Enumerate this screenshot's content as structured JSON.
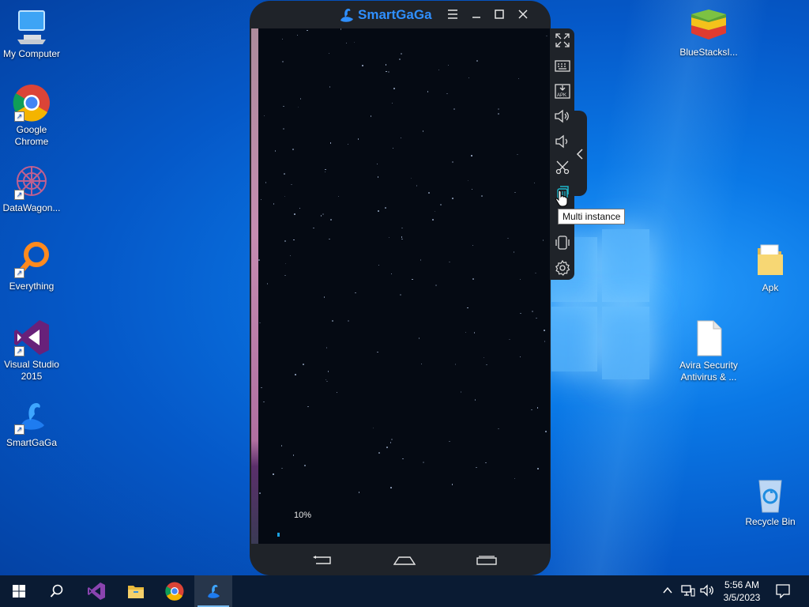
{
  "desktop_left": [
    {
      "label": "My Computer"
    },
    {
      "label": "Google Chrome"
    },
    {
      "label": "DataWagon..."
    },
    {
      "label": "Everything"
    },
    {
      "label": "Visual Studio 2015"
    },
    {
      "label": "SmartGaGa"
    }
  ],
  "desktop_right": [
    {
      "label": "BlueStacksI..."
    },
    {
      "label": "Apk"
    },
    {
      "label": "Avira Security Antivirus & ..."
    },
    {
      "label": "Recycle Bin"
    }
  ],
  "emulator": {
    "brand": "SmartGaGa",
    "loading_text": "10%",
    "loading_progress": 0.1,
    "tooltip": "Multi instance"
  },
  "taskbar": {
    "time": "5:56 AM",
    "date": "3/5/2023"
  },
  "colors": {
    "accent": "#2f8fff",
    "progress": "#1aa0e0",
    "taskbar": "#0a1b33"
  }
}
